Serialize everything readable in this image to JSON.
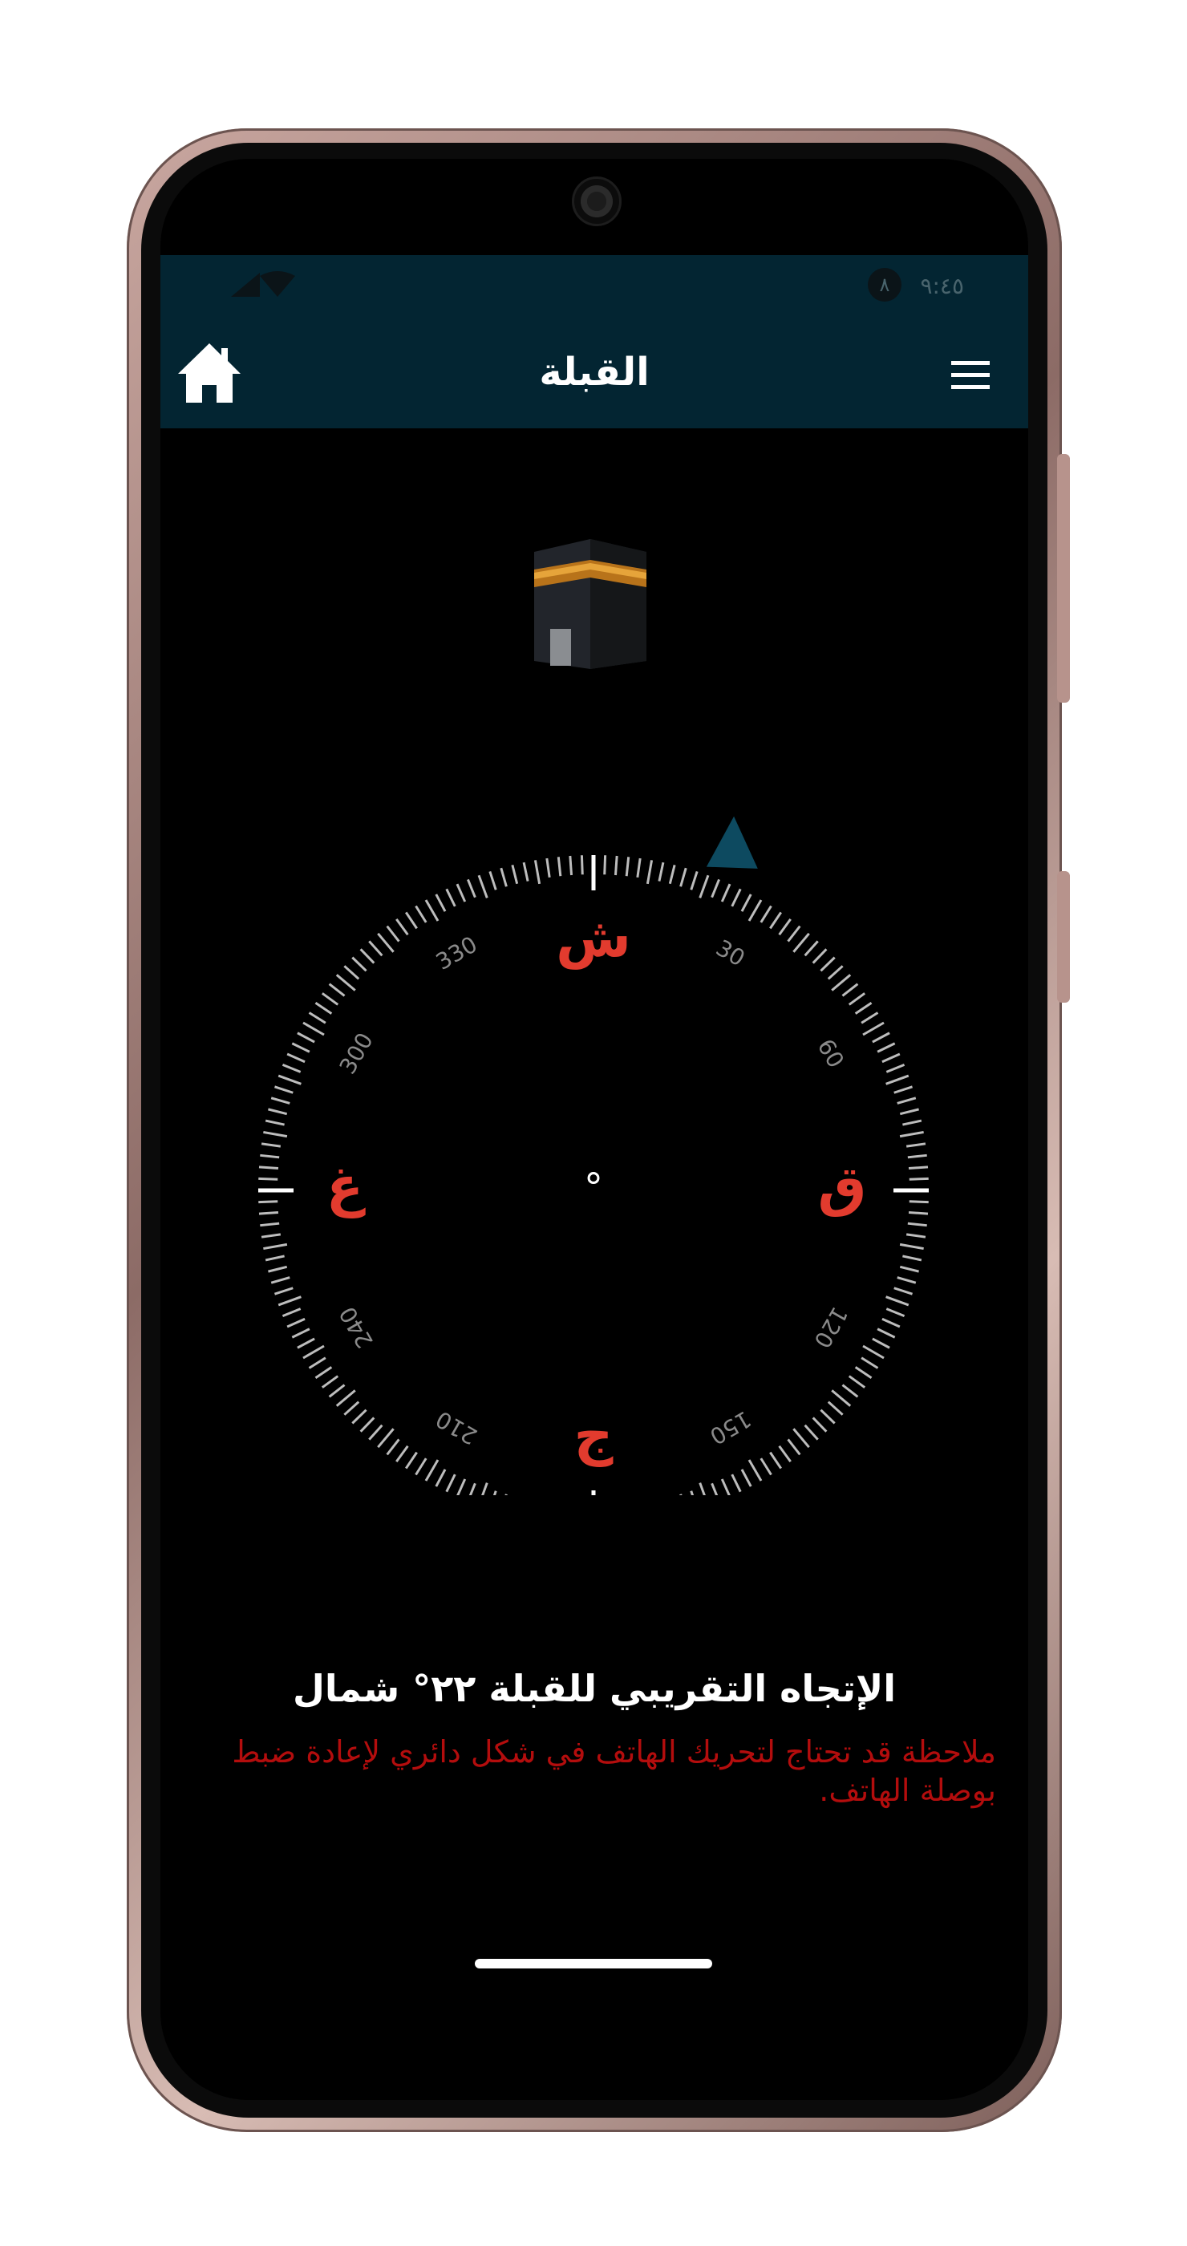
{
  "status_bar": {
    "time": "٩:٤٥",
    "badge": "٨",
    "signal_icon": "signal-icon",
    "wifi_icon": "wifi-icon"
  },
  "app_bar": {
    "title": "القبلة",
    "home_icon": "home-icon",
    "menu_icon": "menu-icon"
  },
  "compass": {
    "heading": "°",
    "cardinals": {
      "north": "ش",
      "east": "ق",
      "south": "ج",
      "west": "غ"
    },
    "ticks": [
      "30",
      "60",
      "120",
      "150",
      "210",
      "240",
      "300",
      "330"
    ],
    "qibla_bearing_deg": 22,
    "colors": {
      "cardinal": "#e23b2e",
      "qibla_pointer": "#0d4a60",
      "ticks": "#bdbdbd"
    }
  },
  "info": {
    "direction_text": "الإتجاه التقريبي للقبلة ٢٢° شمال",
    "note_text": "ملاحظة قد تحتاج لتحريك الهاتف في شكل دائري لإعادة ضبط بوصلة الهاتف."
  },
  "colors": {
    "app_bar": "#032532",
    "note": "#b30d0d"
  }
}
